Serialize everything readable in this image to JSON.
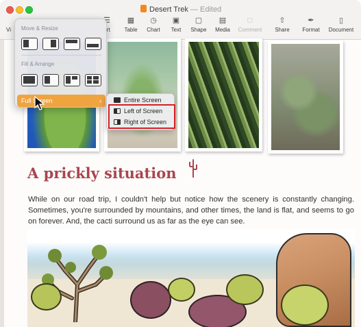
{
  "window": {
    "title": "Desert Trek",
    "title_separator": "—",
    "edited_label": "Edited"
  },
  "toolbar": {
    "partial_left_label": "Vi",
    "items": [
      {
        "label": "ert",
        "icon": "insert-icon"
      },
      {
        "label": "Table",
        "icon": "table-icon"
      },
      {
        "label": "Chart",
        "icon": "chart-icon"
      },
      {
        "label": "Text",
        "icon": "text-icon"
      },
      {
        "label": "Shape",
        "icon": "shape-icon"
      },
      {
        "label": "Media",
        "icon": "media-icon"
      },
      {
        "label": "Comment",
        "icon": "comment-icon",
        "disabled": true
      },
      {
        "label": "Share",
        "icon": "share-icon"
      },
      {
        "label": "Format",
        "icon": "format-icon"
      },
      {
        "label": "Document",
        "icon": "document-icon"
      }
    ]
  },
  "tile_menu": {
    "section_move_resize": "Move & Resize",
    "section_fill_arrange": "Fill & Arrange",
    "full_screen_label": "Full Screen"
  },
  "full_screen_submenu": {
    "items": [
      {
        "label": "Entire Screen",
        "icon": "entire-screen-icon"
      },
      {
        "label": "Left of Screen",
        "icon": "left-of-screen-icon"
      },
      {
        "label": "Right of Screen",
        "icon": "right-of-screen-icon"
      }
    ]
  },
  "document": {
    "heading": "A prickly situation",
    "paragraph": "While on our road trip, I couldn't help but notice how the scenery is constantly changing. Sometimes, you're surrounded by mountains, and other times, the land is flat, and seems to go on forever. And, the cacti surround us as far as the eye can see."
  },
  "colors": {
    "accent_orange": "#f0a440",
    "heading_red": "#a8464f",
    "highlight_red": "#d51f26"
  }
}
